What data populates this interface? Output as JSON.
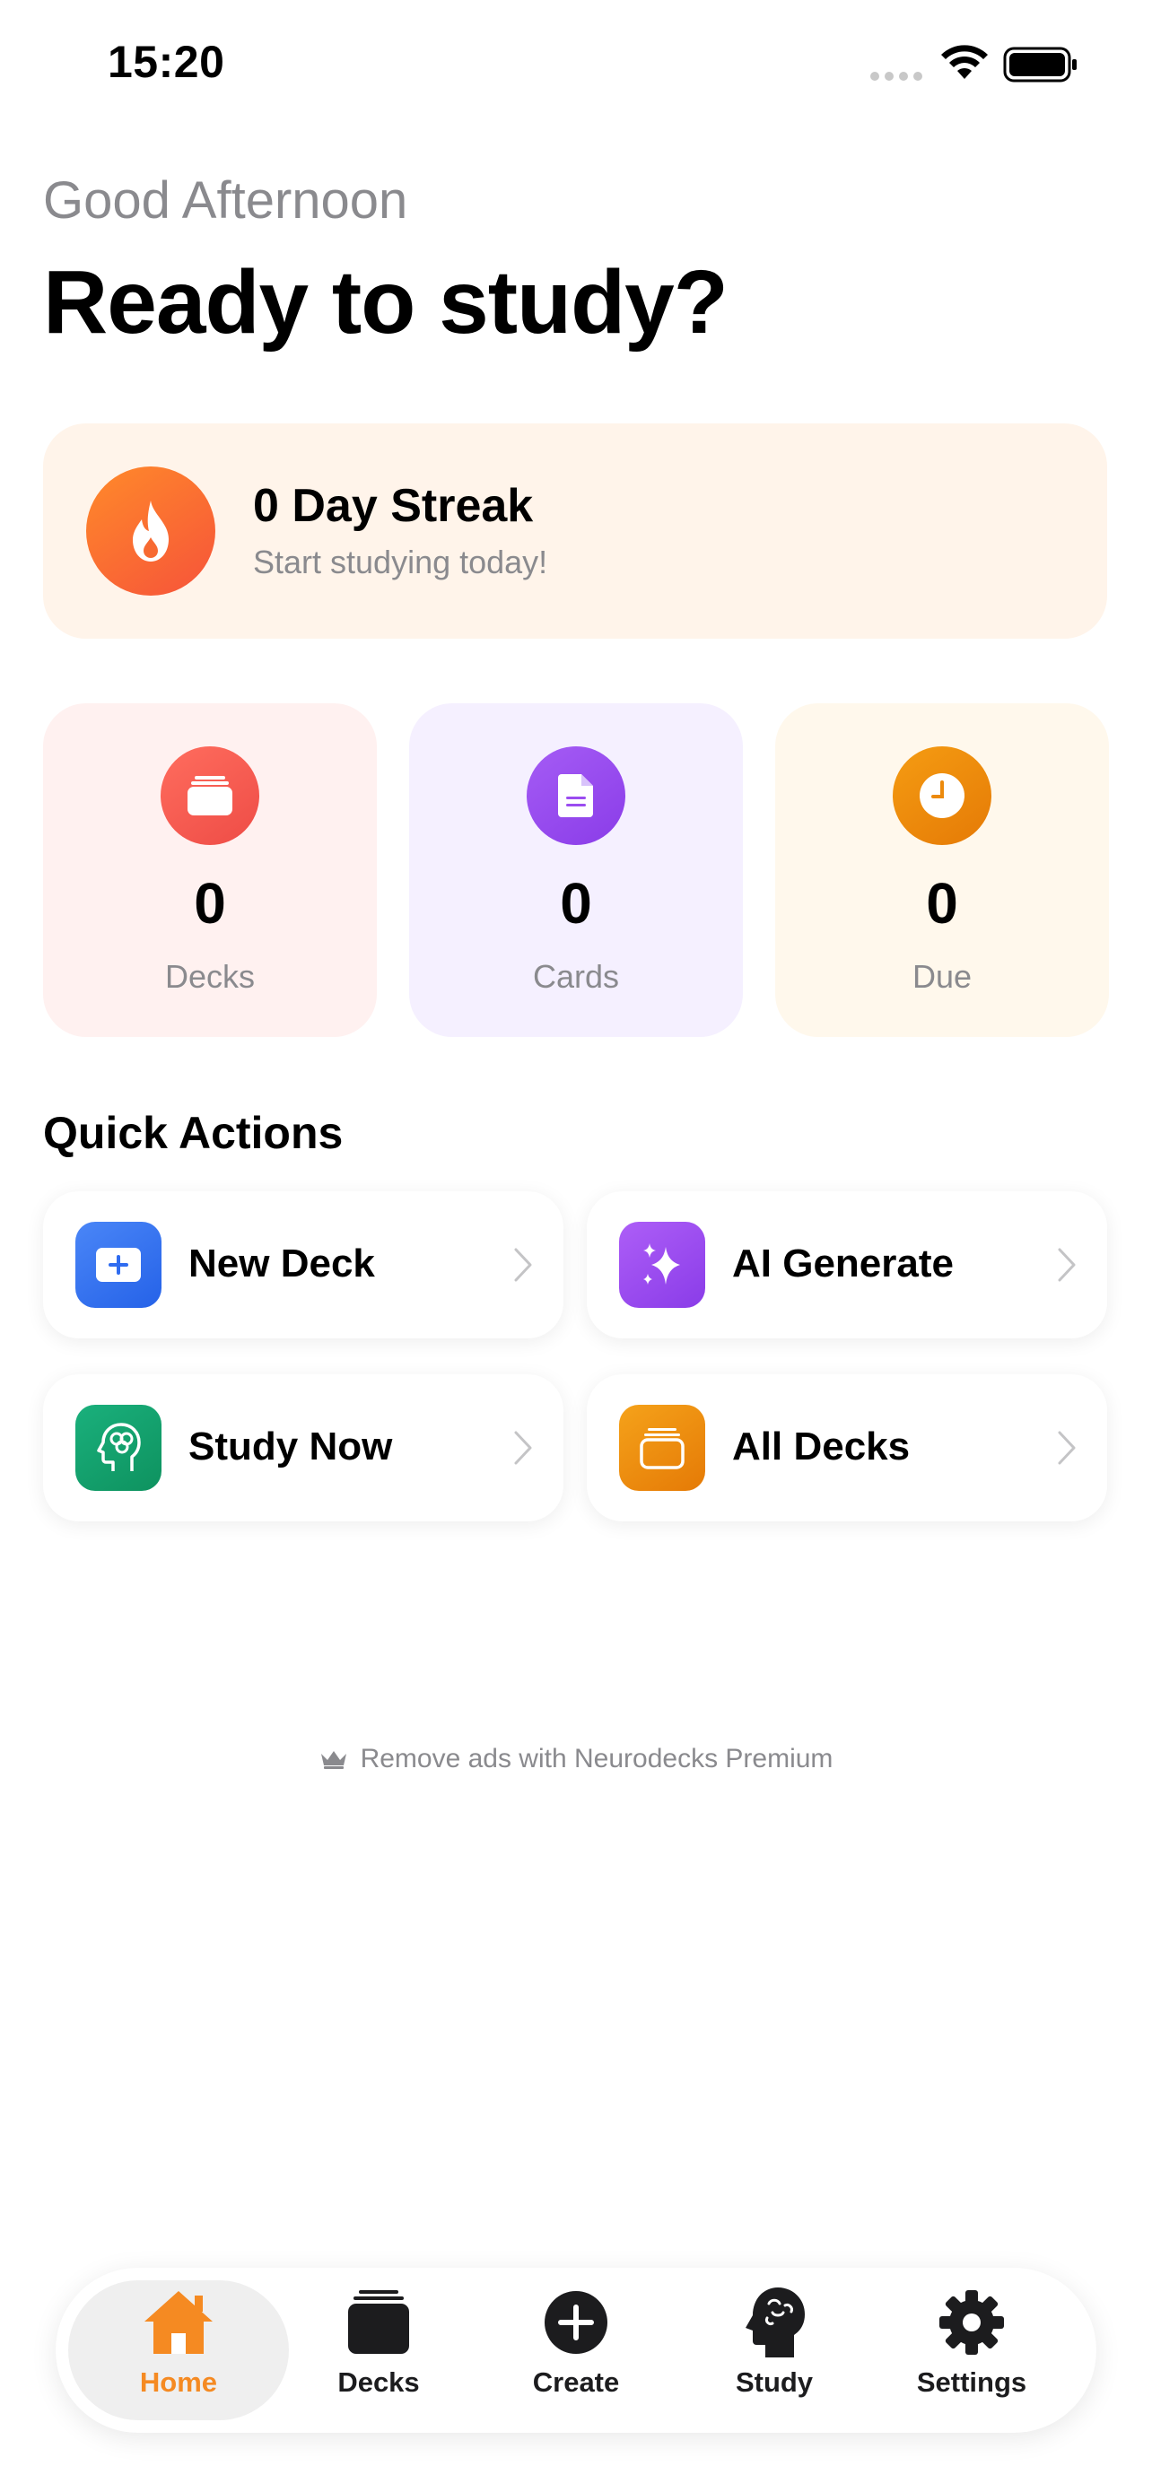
{
  "status_bar": {
    "time": "15:20"
  },
  "header": {
    "greeting": "Good Afternoon",
    "title": "Ready to study?"
  },
  "streak": {
    "title": "0 Day Streak",
    "subtitle": "Start studying today!",
    "icon": "flame-icon"
  },
  "stats": [
    {
      "value": "0",
      "label": "Decks",
      "icon": "deck-icon",
      "color": "#f55a4e"
    },
    {
      "value": "0",
      "label": "Cards",
      "icon": "document-icon",
      "color": "#9b4cf0"
    },
    {
      "value": "0",
      "label": "Due",
      "icon": "clock-icon",
      "color": "#ec8a0c"
    }
  ],
  "quick_actions": {
    "title": "Quick Actions",
    "items": [
      {
        "label": "New Deck",
        "icon": "plus-card-icon",
        "color": "#2f6cf0"
      },
      {
        "label": "AI Generate",
        "icon": "sparkles-icon",
        "color": "#9b4cf0"
      },
      {
        "label": "Study Now",
        "icon": "brain-head-icon",
        "color": "#15a06f"
      },
      {
        "label": "All Decks",
        "icon": "stack-icon",
        "color": "#ec8a0c"
      }
    ]
  },
  "premium": {
    "text": "Remove ads with Neurodecks Premium",
    "icon": "crown-icon"
  },
  "tabbar": {
    "active": "Home",
    "accent": "#f58a22",
    "items": [
      {
        "label": "Home",
        "icon": "home-icon"
      },
      {
        "label": "Decks",
        "icon": "decks-icon"
      },
      {
        "label": "Create",
        "icon": "plus-circle-icon"
      },
      {
        "label": "Study",
        "icon": "brain-head-icon"
      },
      {
        "label": "Settings",
        "icon": "gear-icon"
      }
    ]
  }
}
